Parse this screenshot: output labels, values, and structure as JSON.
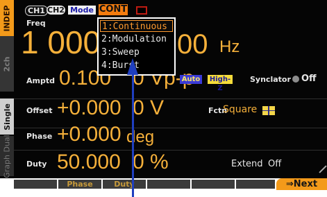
{
  "tabs": {
    "indep": "INDEP",
    "ch2": "2ch",
    "single": "Single",
    "graph_dual": "Graph Dual"
  },
  "status": {
    "ch1": "CH1",
    "ch2": "CH2",
    "mode_label": "Mode",
    "mode_value": "CONT"
  },
  "freq": {
    "label": "Freq",
    "value_left": "1 000.0",
    "value_right": "00",
    "unit": "Hz"
  },
  "amptd": {
    "label": "Amptd",
    "value": "0.100",
    "tail": "0 Vp-p",
    "auto": "Auto",
    "highz": "High-Z"
  },
  "synclator": {
    "label": "Synclator",
    "value": "Off"
  },
  "offset": {
    "label": "Offset",
    "value": "+0.000",
    "tail": "0 V"
  },
  "fctn": {
    "label": "Fctn",
    "value": "Square"
  },
  "phase": {
    "label": "Phase",
    "value": "+0.000",
    "tail": "deg"
  },
  "duty": {
    "label": "Duty",
    "value": "50.000",
    "tail": "0 %"
  },
  "extend": {
    "label": "Extend",
    "value": "Off"
  },
  "menu": {
    "items": [
      {
        "label": "1:Continuous",
        "selected": true
      },
      {
        "label": "2:Modulation",
        "selected": false
      },
      {
        "label": "3:Sweep",
        "selected": false
      },
      {
        "label": "4:Burst",
        "selected": false
      }
    ]
  },
  "softkeys": {
    "phase": "Phase",
    "duty": "Duty",
    "next": "⇒Next"
  },
  "icons": {
    "synclator_dot": "circle-icon",
    "square_wave": "square-wave-icon",
    "annotation_arrow": "arrow-up-icon"
  },
  "colors": {
    "accent": "#f39a1a",
    "value_text": "#f5b03a",
    "arrow": "#1f3fbf"
  }
}
